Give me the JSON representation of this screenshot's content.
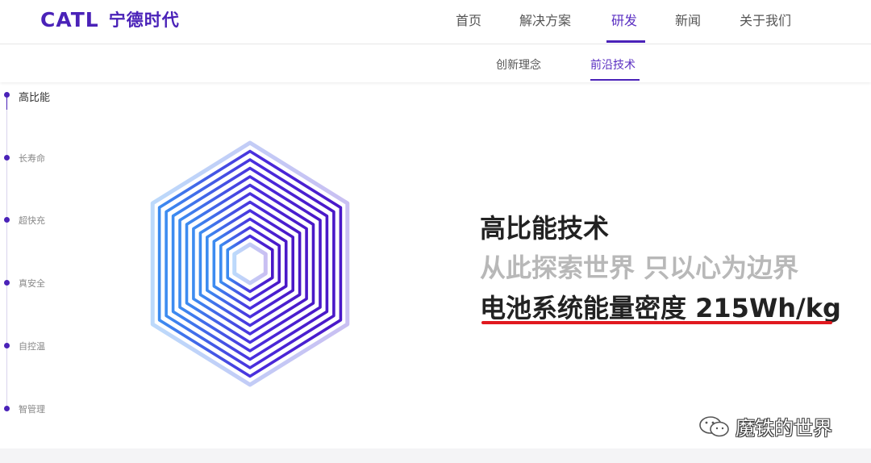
{
  "header": {
    "logo_latin": "CATL",
    "logo_cn": "宁德时代",
    "nav": [
      {
        "label": "首页"
      },
      {
        "label": "解决方案"
      },
      {
        "label": "研发",
        "active": true
      },
      {
        "label": "新闻"
      },
      {
        "label": "关于我们"
      }
    ]
  },
  "subnav": [
    {
      "label": "创新理念"
    },
    {
      "label": "前沿技术",
      "active": true
    }
  ],
  "timeline": [
    {
      "label": "高比能",
      "active": true
    },
    {
      "label": "长寿命"
    },
    {
      "label": "超快充"
    },
    {
      "label": "真安全"
    },
    {
      "label": "自控温"
    },
    {
      "label": "智管理"
    }
  ],
  "hero": {
    "title": "高比能技术",
    "slogan": "从此探索世界 只以心为边界",
    "stat": "电池系统能量密度 215Wh/kg"
  },
  "watermark": {
    "icon": "wechat-icon",
    "text": "魔铁的世界"
  },
  "colors": {
    "brand": "#4a22b8",
    "accent_red": "#e0191f",
    "muted_text": "#b8b8b8"
  }
}
